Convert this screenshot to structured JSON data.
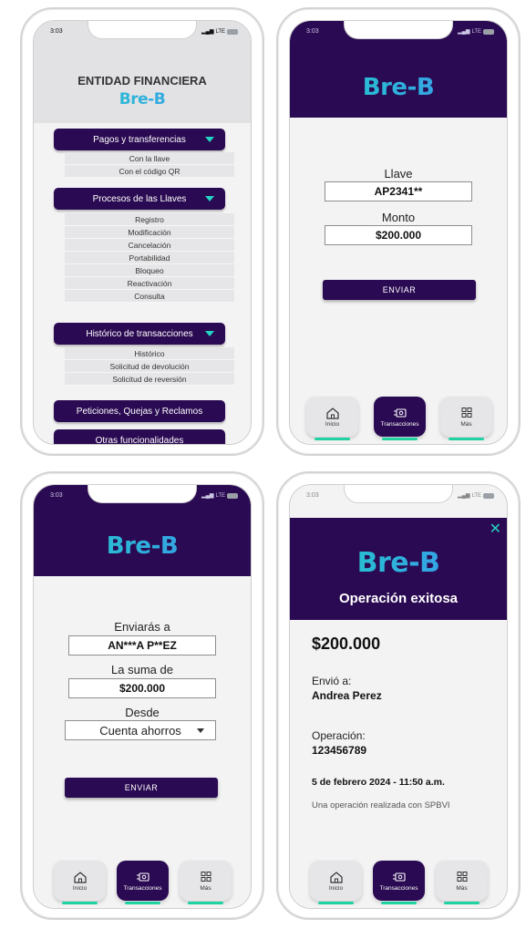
{
  "status": {
    "time": "3:03",
    "network": "LTE"
  },
  "brand": "Bre-B",
  "screen1": {
    "title": "ENTIDAD FINANCIERA",
    "groups": [
      {
        "label": "Pagos y transferencias",
        "items": [
          "Con la llave",
          "Con el código QR"
        ]
      },
      {
        "label": "Procesos de las Llaves",
        "items": [
          "Registro",
          "Modificación",
          "Cancelación",
          "Portabilidad",
          "Bloqueo",
          "Reactivación",
          "Consulta"
        ]
      },
      {
        "label": "Histórico de transacciones",
        "items": [
          "Histórico",
          "Solicitud de devolución",
          "Solicitud de reversión"
        ]
      }
    ],
    "pqr_label": "Peticiones, Quejas y Reclamos",
    "other_label": "Otras funcionalidades"
  },
  "screen2": {
    "key_label": "Llave",
    "key_value": "AP2341**",
    "amount_label": "Monto",
    "amount_value": "$200.000",
    "send_label": "ENVIAR"
  },
  "screen3": {
    "to_label": "Enviarás a",
    "to_value": "AN***A P**EZ",
    "sum_label": "La suma de",
    "sum_value": "$200.000",
    "from_label": "Desde",
    "from_value": "Cuenta ahorros",
    "send_label": "ENVIAR"
  },
  "screen4": {
    "title": "Operación exitosa",
    "amount": "$200.000",
    "sent_to_label": "Envió a:",
    "sent_to_value": "Andrea Perez",
    "operation_label": "Operación:",
    "operation_value": "123456789",
    "date": "5 de febrero 2024 - 11:50 a.m.",
    "note": "Una operación realizada con SPBVI"
  },
  "nav": {
    "home": "Inicio",
    "transactions": "Transacciones",
    "more": "Más"
  },
  "colors": {
    "primary": "#2a0a52",
    "accent": "#1fd2c4",
    "accent2": "#3e8ff3",
    "underline": "#1fd2a2"
  }
}
